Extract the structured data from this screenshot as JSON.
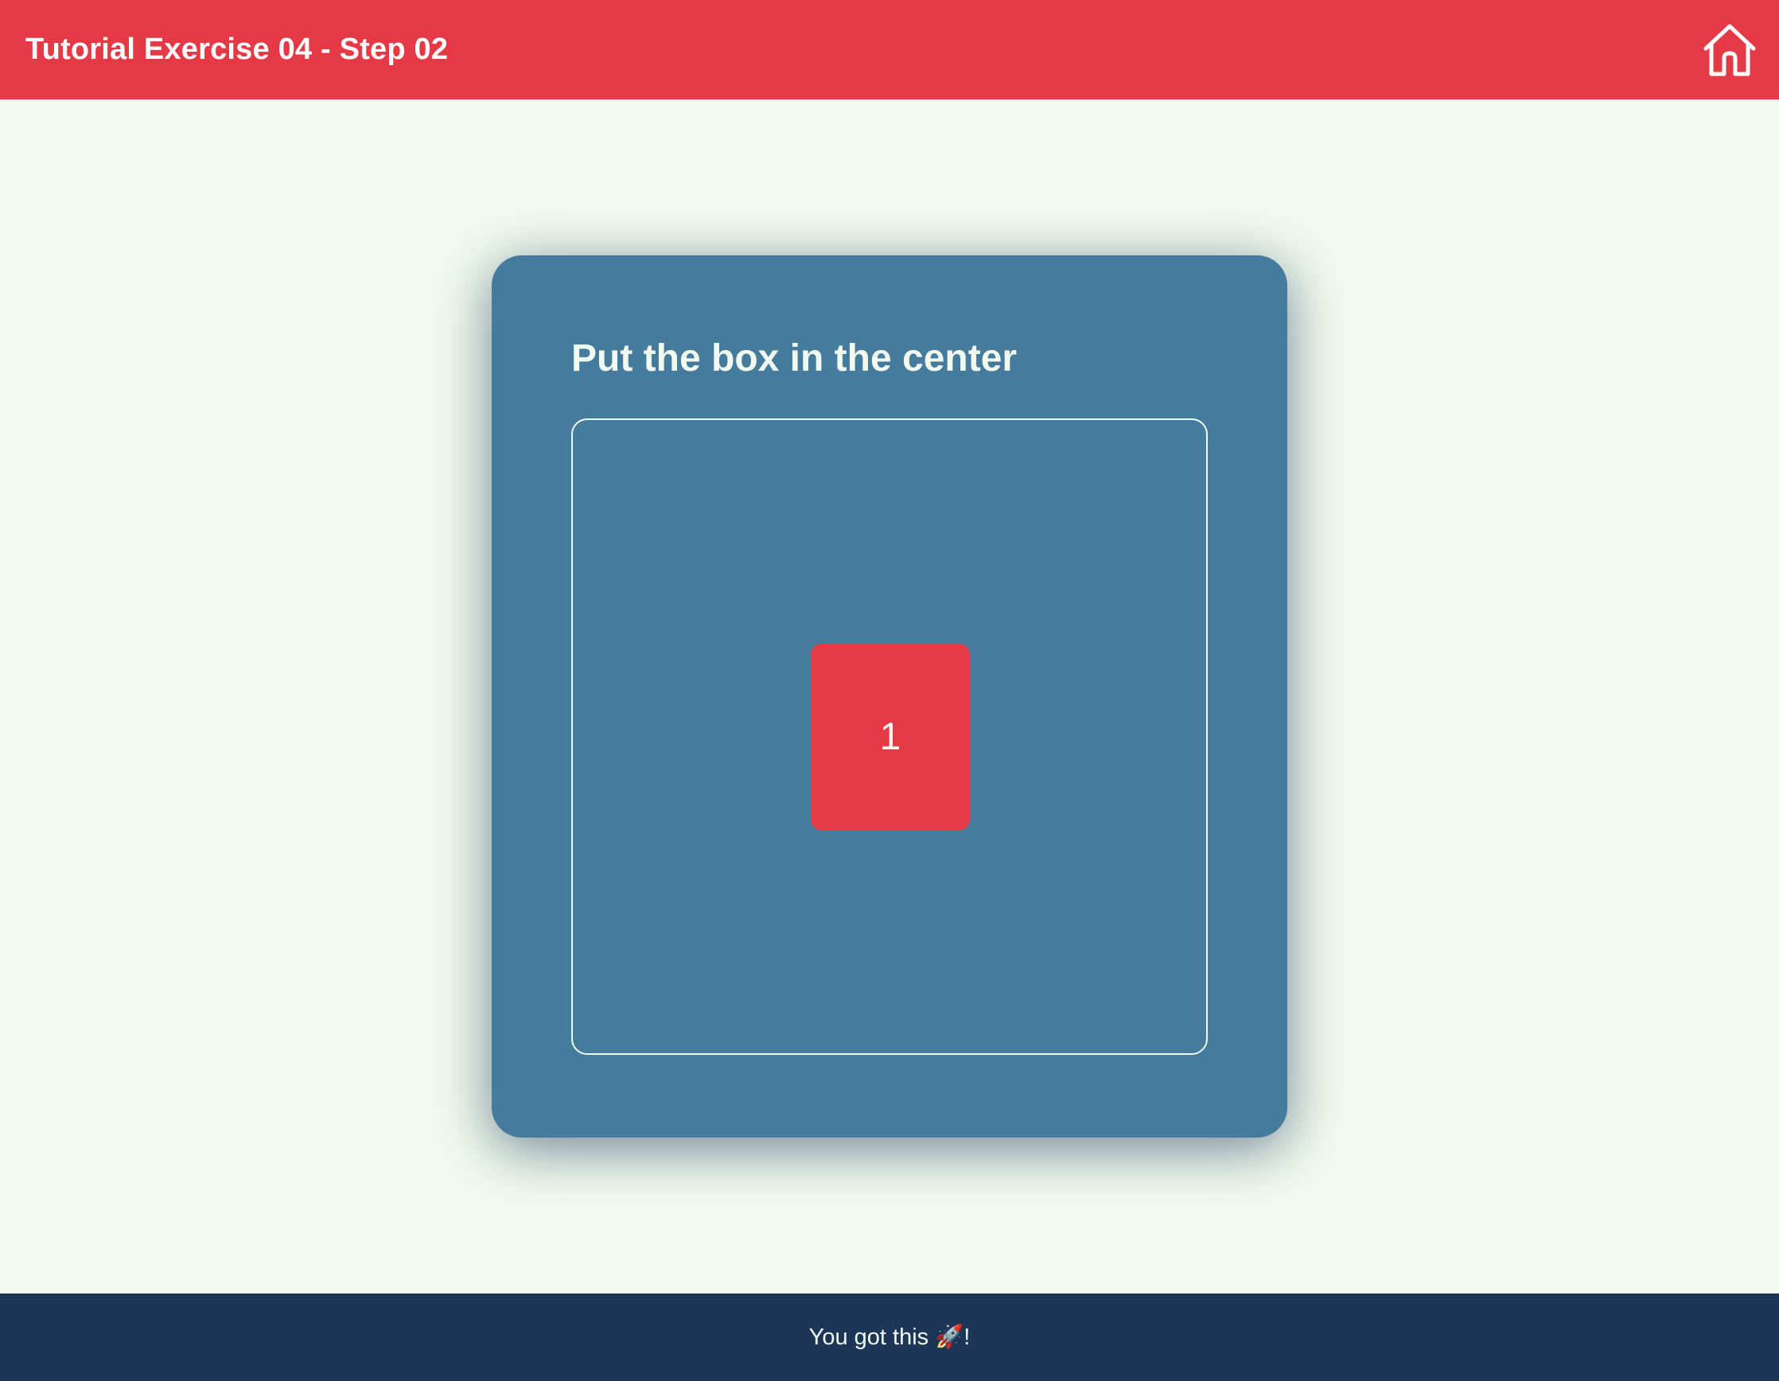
{
  "header": {
    "title": "Tutorial Exercise 04 - Step 02",
    "home_icon": "home-icon"
  },
  "card": {
    "title": "Put the box in the center",
    "box_label": "1"
  },
  "footer": {
    "text": "You got this 🚀!"
  },
  "colors": {
    "header": "#e63946",
    "background": "#f1faee",
    "card": "#457b9d",
    "box": "#e63946",
    "footer": "#1d3557"
  }
}
